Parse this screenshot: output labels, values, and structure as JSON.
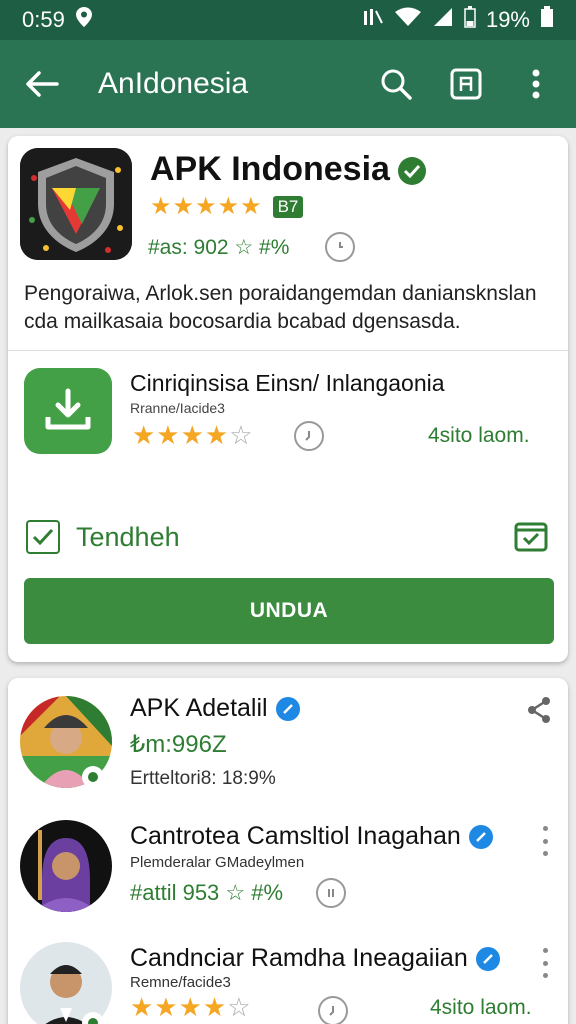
{
  "status": {
    "time": "0:59",
    "battery": "19%"
  },
  "appbar": {
    "title": "AnIdonesia"
  },
  "app": {
    "title": "APK Indonesia",
    "badge": "B7",
    "meta": "#as: 902 ☆ #%",
    "description": "Pengoraiwa, Arlok.sen poraidangemdan daniansknslan cda mailkasaia bocosardia bcabad dgensasda."
  },
  "feature": {
    "title": "Cinriqinsisa Einsn/ Inlangaonia",
    "subtitle": "Rranne/Iacide3",
    "rating": "4sito laom.",
    "checkbox_label": "Tendheh",
    "cta": "UNDUA"
  },
  "list": [
    {
      "title": "APK Adetalil",
      "line": "₺m:996Z",
      "extra": "Ertteltori8: 18:9%"
    },
    {
      "title": "Cantrotea Camsltiol Inagahan",
      "small": "Plemderalar GMadeylmen",
      "line": "#attil 953 ☆ #%"
    },
    {
      "title": "Candnciar Ramdha Ineagaiian",
      "small": "Remne/facide3",
      "rating": "4sito laom."
    }
  ],
  "colors": {
    "appbar": "#2a7454",
    "statusbar": "#1e5e44",
    "accent": "#2e7d32",
    "verified_blue": "#1e88e5"
  }
}
